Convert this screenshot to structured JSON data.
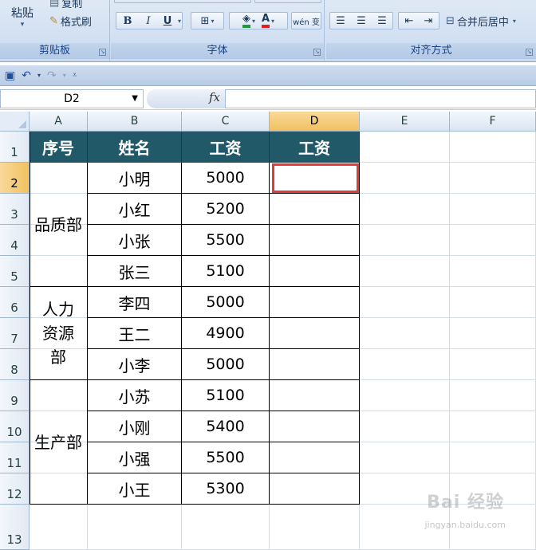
{
  "ribbon": {
    "clipboard": {
      "paste": "粘贴",
      "copy": "复制",
      "format_painter": "格式刷",
      "title": "剪贴板"
    },
    "font": {
      "title": "字体",
      "bold": "B",
      "italic": "I",
      "underline": "U",
      "font_color": "A",
      "phonetic": "wén 变"
    },
    "alignment": {
      "title": "对齐方式",
      "merge_center": "合并后居中"
    }
  },
  "formula_bar": {
    "name_box": "D2",
    "fx": "fx",
    "value": ""
  },
  "sheet": {
    "columns": [
      "A",
      "B",
      "C",
      "D",
      "E",
      "F"
    ],
    "active_column": "D",
    "rows": [
      "1",
      "2",
      "3",
      "4",
      "5",
      "6",
      "7",
      "8",
      "9",
      "10",
      "11",
      "12",
      "13"
    ],
    "active_row": "2",
    "header": [
      "序号",
      "姓名",
      "工资",
      "工资"
    ],
    "departments": [
      {
        "name": "品质部",
        "lines": [
          "品质部"
        ]
      },
      {
        "name": "人力资源部",
        "lines": [
          "人力",
          "资源",
          "部"
        ]
      },
      {
        "name": "生产部",
        "lines": [
          "生产部"
        ]
      }
    ],
    "records": [
      {
        "name": "小明",
        "salary": "5000"
      },
      {
        "name": "小红",
        "salary": "5200"
      },
      {
        "name": "小张",
        "salary": "5500"
      },
      {
        "name": "张三",
        "salary": "5100"
      },
      {
        "name": "李四",
        "salary": "5000"
      },
      {
        "name": "王二",
        "salary": "4900"
      },
      {
        "name": "小李",
        "salary": "5000"
      },
      {
        "name": "小苏",
        "salary": "5100"
      },
      {
        "name": "小刚",
        "salary": "5400"
      },
      {
        "name": "小强",
        "salary": "5500"
      },
      {
        "name": "小王",
        "salary": "5300"
      }
    ]
  },
  "colors": {
    "header_fill": "#215968",
    "header_text": "#ffffff",
    "selection": "#e03a3a",
    "active_header": "#f1c15f"
  },
  "watermark": {
    "main": "Bai 经验",
    "sub": "jingyan.baidu.com"
  }
}
